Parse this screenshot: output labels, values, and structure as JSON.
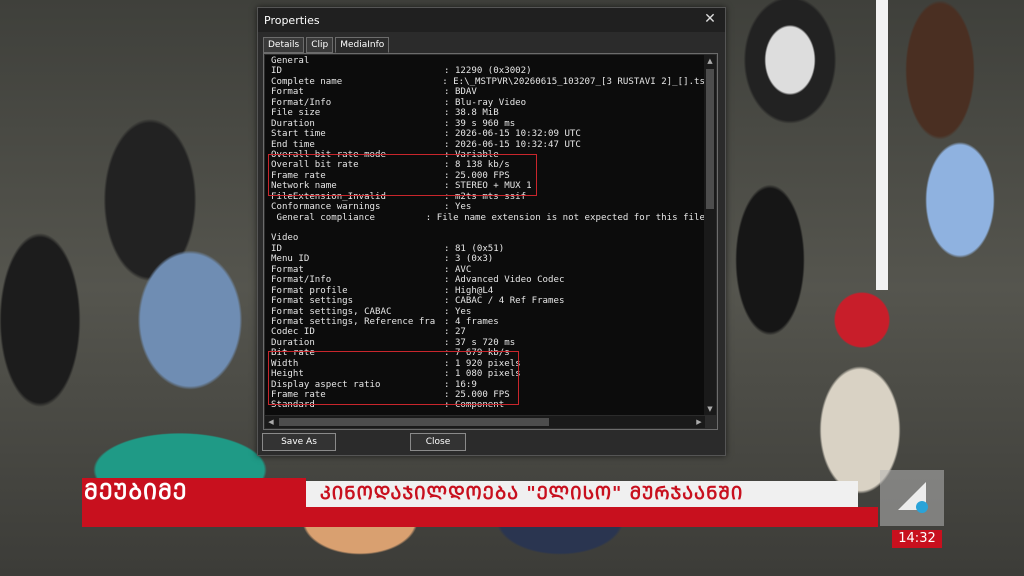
{
  "window": {
    "title": "Properties",
    "close_glyph": "✕"
  },
  "tabs": [
    "Details",
    "Clip",
    "MediaInfo"
  ],
  "active_tab": "MediaInfo",
  "mediainfo_rows": [
    [
      "General",
      ""
    ],
    [
      "ID",
      ": 12290 (0x3002)"
    ],
    [
      "Complete name",
      ": E:\\_MSTPVR\\20260615_103207_[3 RUSTAVI 2]_[].ts"
    ],
    [
      "Format",
      ": BDAV"
    ],
    [
      "Format/Info",
      ": Blu-ray Video"
    ],
    [
      "File size",
      ": 38.8 MiB"
    ],
    [
      "Duration",
      ": 39 s 960 ms"
    ],
    [
      "Start time",
      ": 2026-06-15 10:32:09 UTC"
    ],
    [
      "End time",
      ": 2026-06-15 10:32:47 UTC"
    ],
    [
      "Overall bit rate mode",
      ": Variable"
    ],
    [
      "Overall bit rate",
      ": 8 138 kb/s"
    ],
    [
      "Frame rate",
      ": 25.000 FPS"
    ],
    [
      "Network name",
      ": STEREO + MUX 1"
    ],
    [
      "FileExtension_Invalid",
      ": m2ts mts ssif"
    ],
    [
      "Conformance warnings",
      ": Yes"
    ],
    [
      " General compliance",
      ": File name extension is not expected for this file"
    ],
    [
      "",
      ""
    ],
    [
      "Video",
      ""
    ],
    [
      "ID",
      ": 81 (0x51)"
    ],
    [
      "Menu ID",
      ": 3 (0x3)"
    ],
    [
      "Format",
      ": AVC"
    ],
    [
      "Format/Info",
      ": Advanced Video Codec"
    ],
    [
      "Format profile",
      ": High@L4"
    ],
    [
      "Format settings",
      ": CABAC / 4 Ref Frames"
    ],
    [
      "Format settings, CABAC",
      ": Yes"
    ],
    [
      "Format settings, Reference fra",
      ": 4 frames"
    ],
    [
      "Codec ID",
      ": 27"
    ],
    [
      "Duration",
      ": 37 s 720 ms"
    ],
    [
      "Bit rate",
      ": 7 679 kb/s"
    ],
    [
      "Width",
      ": 1 920 pixels"
    ],
    [
      "Height",
      ": 1 080 pixels"
    ],
    [
      "Display aspect ratio",
      ": 16:9"
    ],
    [
      "Frame rate",
      ": 25.000 FPS"
    ],
    [
      "Standard",
      ": Component"
    ]
  ],
  "buttons": {
    "save_as": "Save As",
    "close": "Close"
  },
  "ticker": {
    "label": "ᲛᲔᲣᲑᲘᲛᲔ",
    "headline": "ᲙᲘᲜᲝᲓᲐᲯᲘᲚᲓᲝᲔᲑᲐ \"ᲔᲚᲘᲡᲝ\" ᲛᲣᲠᲯᲐᲐᲜᲨᲘ",
    "clock": "14:32",
    "red": "#c8101e"
  }
}
